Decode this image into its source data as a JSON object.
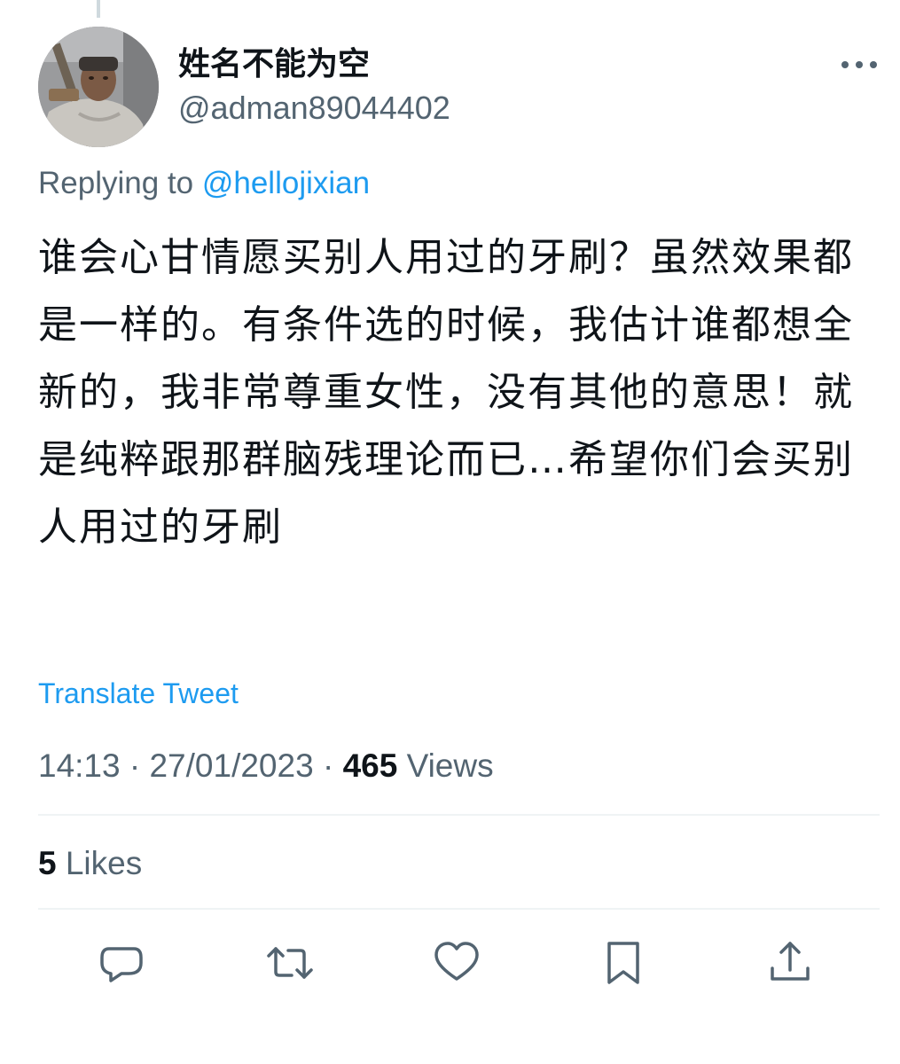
{
  "user": {
    "display_name": "姓名不能为空",
    "handle": "@adman89044402"
  },
  "reply": {
    "prefix": "Replying to",
    "mention": "@hellojixian"
  },
  "tweet": {
    "text": "谁会心甘情愿买别人用过的牙刷？虽然效果都是一样的。有条件选的时候，我估计谁都想全新的，我非常尊重女性，没有其他的意思！就是纯粹跟那群脑残理论而已…希望你们会买别人用过的牙刷",
    "translate_label": "Translate Tweet"
  },
  "meta": {
    "time": "14:13",
    "separator": "·",
    "date": "27/01/2023",
    "views_count": "465",
    "views_label": "Views"
  },
  "stats": {
    "likes_count": "5",
    "likes_label": "Likes"
  },
  "actions": [
    "reply-icon",
    "retweet-icon",
    "like-icon",
    "bookmark-icon",
    "share-icon"
  ],
  "colors": {
    "text": "#0f1419",
    "secondary": "#536471",
    "accent": "#1d9bf0",
    "divider": "#eff3f4"
  }
}
